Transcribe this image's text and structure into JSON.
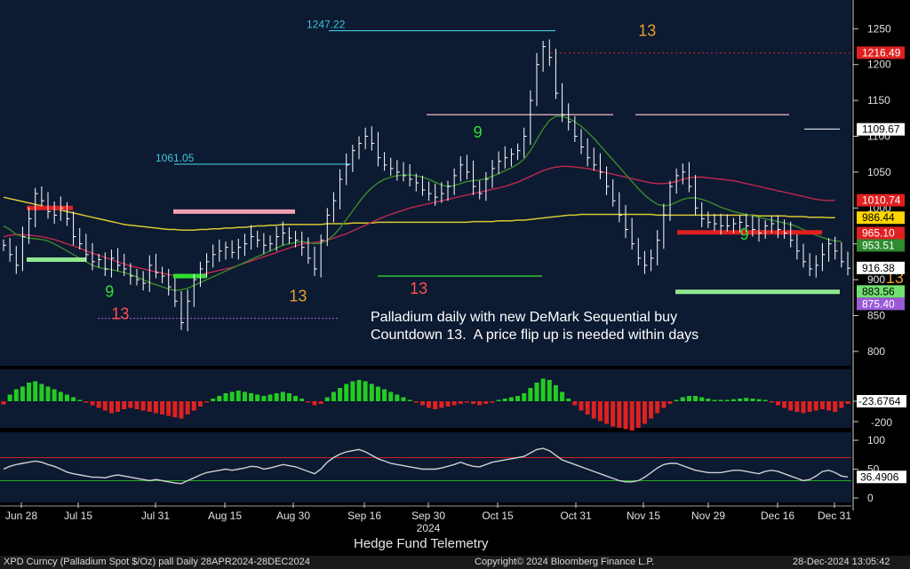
{
  "annotation": "Palladium daily with new DeMark Sequential buy\nCountdown 13.  A price flip up is needed within days",
  "footer": {
    "source": "Hedge Fund Telemetry",
    "security": "XPD Curncy (Palladium Spot  $/Oz) pall  Daily 28APR2024-28DEC2024",
    "copyright": "Copyright© 2024 Bloomberg Finance L.P.",
    "timestamp": "28-Dec-2024 13:05:42"
  },
  "colors": {
    "background": "#000000",
    "plot_bg": "#0c1a32",
    "price_bar": "#ffffff",
    "ma_short": "#3a8a2a",
    "ma_mid": "#c0294f",
    "ma_long": "#d8c832",
    "resistance": "#e02020",
    "support": "#70e070",
    "hist_pos": "#22cc22",
    "hist_neg": "#dd2222",
    "osc_line": "#d0d0d0",
    "osc_upper": "#cc2222",
    "osc_lower": "#22aa22"
  },
  "chart_data": {
    "type": "line",
    "title": "",
    "x_ticks": [
      "Jun 28",
      "Jul 15",
      "Jul 31",
      "Aug 15",
      "Aug 30",
      "Sep 16",
      "Sep 30",
      "Oct 15",
      "Oct 31",
      "Nov 15",
      "Nov 29",
      "Dec 16",
      "Dec 31"
    ],
    "year_label": "2024",
    "y_ticks": [
      800,
      850,
      900,
      950,
      1000,
      1050,
      1100,
      1150,
      1200,
      1250
    ],
    "ylim": [
      780,
      1290
    ],
    "price_markers": [
      {
        "value": 1216.49,
        "label": "1216.49",
        "bg": "#e02020",
        "fg": "#ffffff"
      },
      {
        "value": 1109.67,
        "label": "1109.67",
        "bg": "#ffffff",
        "fg": "#000000"
      },
      {
        "value": 1010.74,
        "label": "1010.74",
        "bg": "#e02020",
        "fg": "#ffffff"
      },
      {
        "value": 986.44,
        "label": "986.44",
        "bg": "#ffd700",
        "fg": "#000000"
      },
      {
        "value": 965.1,
        "label": "965.10",
        "bg": "#e02020",
        "fg": "#ffffff"
      },
      {
        "value": 953.51,
        "label": "953.51",
        "bg": "#2e8b2e",
        "fg": "#ffffff"
      },
      {
        "value": 916.38,
        "label": "916.38",
        "bg": "#ffffff",
        "fg": "#000000"
      },
      {
        "value": 883.56,
        "label": "883.56",
        "bg": "#70e070",
        "fg": "#000000"
      },
      {
        "value": 875.4,
        "label": "875.40",
        "bg": "#9a5ad8",
        "fg": "#ffffff"
      }
    ],
    "level_labels": [
      {
        "value": 1247.22,
        "label": "1247.22"
      },
      {
        "value": 1061.05,
        "label": "1061.05"
      }
    ],
    "close_series": [
      948,
      935,
      920,
      960,
      985,
      1020,
      1010,
      995,
      990,
      1000,
      985,
      960,
      950,
      935,
      925,
      928,
      915,
      930,
      920,
      915,
      905,
      900,
      895,
      920,
      910,
      905,
      890,
      870,
      840,
      870,
      900,
      915,
      925,
      935,
      940,
      945,
      938,
      945,
      950,
      960,
      955,
      948,
      950,
      960,
      965,
      958,
      955,
      945,
      930,
      915,
      955,
      990,
      1010,
      1040,
      1060,
      1080,
      1090,
      1100,
      1090,
      1070,
      1060,
      1055,
      1050,
      1045,
      1040,
      1035,
      1025,
      1020,
      1015,
      1020,
      1030,
      1045,
      1060,
      1050,
      1030,
      1020,
      1040,
      1055,
      1065,
      1070,
      1075,
      1080,
      1100,
      1150,
      1200,
      1225,
      1210,
      1160,
      1130,
      1120,
      1100,
      1085,
      1070,
      1060,
      1050,
      1030,
      1010,
      990,
      970,
      950,
      930,
      920,
      930,
      955,
      990,
      1030,
      1045,
      1050,
      1030,
      1000,
      985,
      980,
      978,
      975,
      975,
      978,
      980,
      975,
      970,
      965,
      975,
      978,
      970,
      965,
      955,
      940,
      925,
      915,
      920,
      935,
      950,
      940,
      925,
      916
    ],
    "ma_short": [
      975,
      970,
      963,
      960,
      958,
      957,
      956,
      954,
      950,
      945,
      940,
      935,
      930,
      925,
      920,
      917,
      915,
      914,
      912,
      910,
      907,
      904,
      900,
      896,
      893,
      890,
      887,
      885,
      886,
      888,
      892,
      896,
      900,
      904,
      908,
      912,
      916,
      920,
      924,
      928,
      932,
      936,
      940,
      944,
      948,
      950,
      952,
      953,
      952,
      950,
      951,
      955,
      962,
      972,
      984,
      996,
      1008,
      1019,
      1028,
      1035,
      1040,
      1043,
      1045,
      1046,
      1046,
      1045,
      1043,
      1040,
      1036,
      1032,
      1030,
      1031,
      1034,
      1037,
      1038,
      1039,
      1041,
      1044,
      1048,
      1052,
      1056,
      1061,
      1068,
      1080,
      1095,
      1110,
      1122,
      1128,
      1128,
      1125,
      1120,
      1114,
      1106,
      1097,
      1087,
      1077,
      1067,
      1057,
      1047,
      1037,
      1027,
      1018,
      1011,
      1005,
      1003,
      1004,
      1008,
      1012,
      1014,
      1014,
      1012,
      1009,
      1005,
      1001,
      998,
      995,
      993,
      991,
      989,
      987,
      985,
      983,
      981,
      979,
      977,
      974,
      970,
      966,
      962,
      959,
      956,
      954,
      953.5
    ],
    "ma_mid": [
      960,
      962,
      963,
      963,
      962,
      961,
      960,
      958,
      956,
      953,
      950,
      947,
      944,
      940,
      937,
      934,
      931,
      928,
      925,
      922,
      919,
      917,
      915,
      913,
      911,
      909,
      907,
      906,
      905,
      905,
      906,
      907,
      909,
      911,
      913,
      915,
      917,
      920,
      923,
      926,
      929,
      932,
      935,
      938,
      941,
      944,
      947,
      950,
      951,
      952,
      953,
      955,
      958,
      961,
      964,
      968,
      972,
      976,
      980,
      984,
      988,
      991,
      994,
      997,
      1000,
      1002,
      1004,
      1006,
      1008,
      1010,
      1012,
      1014,
      1016,
      1018,
      1020,
      1022,
      1024,
      1026,
      1028,
      1030,
      1033,
      1036,
      1040,
      1044,
      1048,
      1052,
      1055,
      1057,
      1058,
      1058,
      1057,
      1056,
      1055,
      1053,
      1051,
      1049,
      1047,
      1045,
      1043,
      1041,
      1039,
      1037,
      1035,
      1034,
      1034,
      1035,
      1037,
      1040,
      1042,
      1043,
      1043,
      1042,
      1041,
      1040,
      1039,
      1038,
      1036,
      1034,
      1032,
      1030,
      1028,
      1026,
      1024,
      1022,
      1020,
      1018,
      1016,
      1014,
      1012,
      1011,
      1010.5,
      1010.7
    ],
    "ma_long": [
      1015,
      1013,
      1011,
      1009,
      1007,
      1005,
      1003,
      1001,
      999,
      997,
      995,
      993,
      991,
      989,
      987,
      985,
      983,
      981,
      979,
      977,
      976,
      975,
      974,
      973,
      972,
      971,
      970,
      970,
      969,
      969,
      969,
      970,
      970,
      971,
      971,
      972,
      972,
      973,
      973,
      974,
      975,
      975,
      976,
      976,
      977,
      977,
      977,
      977,
      977,
      977,
      977,
      978,
      978,
      978,
      978,
      979,
      979,
      979,
      979,
      980,
      980,
      980,
      980,
      980,
      980,
      980,
      980,
      980,
      980,
      980,
      980,
      980,
      980,
      980,
      981,
      981,
      981,
      981,
      982,
      982,
      982,
      983,
      983,
      984,
      985,
      986,
      987,
      988,
      989,
      990,
      990,
      991,
      991,
      991,
      991,
      991,
      991,
      991,
      991,
      991,
      991,
      991,
      991,
      990,
      990,
      990,
      990,
      990,
      990,
      990,
      990,
      990,
      990,
      990,
      990,
      990,
      990,
      990,
      990,
      989,
      989,
      989,
      989,
      989,
      988,
      988,
      988,
      987,
      987,
      987,
      986.5,
      986.4
    ],
    "histogram": [
      -5,
      10,
      18,
      22,
      28,
      30,
      26,
      22,
      18,
      14,
      10,
      6,
      2,
      -2,
      -6,
      -10,
      -14,
      -18,
      -16,
      -12,
      -10,
      -12,
      -14,
      -16,
      -18,
      -20,
      -22,
      -24,
      -26,
      -20,
      -14,
      -8,
      -2,
      4,
      8,
      12,
      14,
      16,
      14,
      12,
      10,
      8,
      10,
      12,
      14,
      12,
      8,
      4,
      -2,
      -6,
      -4,
      6,
      14,
      20,
      26,
      30,
      32,
      30,
      26,
      22,
      18,
      14,
      10,
      6,
      2,
      -2,
      -6,
      -10,
      -12,
      -10,
      -8,
      -6,
      -4,
      -2,
      -4,
      -6,
      -4,
      -2,
      2,
      4,
      6,
      8,
      12,
      20,
      28,
      34,
      32,
      24,
      14,
      4,
      -6,
      -14,
      -20,
      -26,
      -30,
      -34,
      -38,
      -40,
      -42,
      -44,
      -40,
      -34,
      -26,
      -18,
      -10,
      -4,
      2,
      6,
      8,
      8,
      6,
      4,
      2,
      2,
      2,
      3,
      4,
      5,
      4,
      3,
      2,
      -2,
      -6,
      -10,
      -14,
      -16,
      -18,
      -16,
      -14,
      -12,
      -14,
      -16,
      -10,
      -4
    ],
    "histogram_value": -23.6764,
    "histogram_ticks": [
      0,
      -200
    ],
    "oscillator": [
      50,
      55,
      58,
      60,
      62,
      64,
      62,
      58,
      55,
      50,
      45,
      42,
      40,
      38,
      36,
      36,
      35,
      38,
      40,
      38,
      36,
      34,
      32,
      30,
      32,
      30,
      28,
      26,
      25,
      30,
      35,
      40,
      44,
      46,
      48,
      50,
      48,
      50,
      52,
      55,
      54,
      50,
      52,
      55,
      58,
      56,
      54,
      50,
      46,
      42,
      50,
      62,
      70,
      76,
      80,
      82,
      84,
      80,
      74,
      68,
      64,
      60,
      58,
      56,
      54,
      52,
      50,
      50,
      50,
      52,
      55,
      58,
      62,
      58,
      55,
      54,
      58,
      62,
      64,
      66,
      68,
      70,
      72,
      78,
      84,
      86,
      82,
      74,
      66,
      62,
      58,
      54,
      50,
      46,
      42,
      38,
      34,
      30,
      28,
      28,
      30,
      36,
      44,
      52,
      58,
      60,
      60,
      56,
      52,
      48,
      46,
      44,
      44,
      44,
      46,
      48,
      48,
      46,
      44,
      42,
      46,
      48,
      46,
      42,
      38,
      34,
      30,
      32,
      38,
      46,
      48,
      44,
      38,
      36.5
    ],
    "oscillator_value": 36.4906,
    "oscillator_levels": {
      "upper": 70,
      "lower": 30
    },
    "oscillator_ticks": [
      100,
      50,
      0
    ],
    "setup_labels": [
      {
        "text": "13",
        "color": "#ff5050",
        "i": 17,
        "v": 845
      },
      {
        "text": "9",
        "color": "#30e030",
        "i": 16,
        "v": 876
      },
      {
        "text": "13",
        "color": "#e8a030",
        "i": 45,
        "v": 870
      },
      {
        "text": "13",
        "color": "#ff5050",
        "i": 64,
        "v": 880
      },
      {
        "text": "9",
        "color": "#30e030",
        "i": 74,
        "v": 1098
      },
      {
        "text": "13",
        "color": "#e8a030",
        "i": 100,
        "v": 1240
      },
      {
        "text": "9",
        "color": "#30e030",
        "i": 116,
        "v": 956
      },
      {
        "text": "13",
        "color": "#e8a030",
        "i": 139,
        "v": 895
      },
      {
        "text": "13",
        "color": "#ff5050",
        "i": 157,
        "v": 870
      }
    ]
  }
}
